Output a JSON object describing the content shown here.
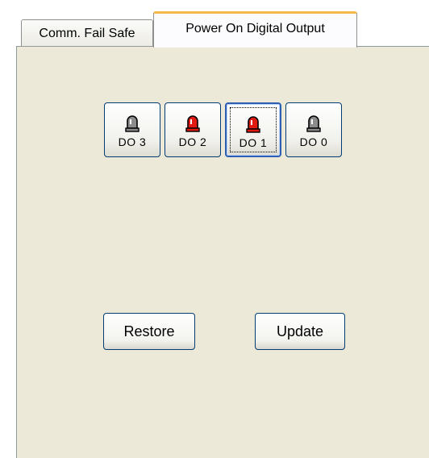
{
  "tabs": [
    {
      "label": "Comm. Fail Safe",
      "active": false
    },
    {
      "label": "Power On Digital Output",
      "active": true
    }
  ],
  "digital_outputs": [
    {
      "label": "DO 3",
      "state": "off",
      "icon": "lamp-off-icon"
    },
    {
      "label": "DO 2",
      "state": "on",
      "icon": "lamp-on-icon"
    },
    {
      "label": "DO 1",
      "state": "on",
      "icon": "lamp-on-icon"
    },
    {
      "label": "DO 0",
      "state": "off",
      "icon": "lamp-off-icon"
    }
  ],
  "buttons": {
    "restore_label": "Restore",
    "update_label": "Update"
  },
  "colors": {
    "lamp_on": "#e21b12",
    "lamp_off": "#8c8c8c",
    "active_tab_accent": "#f5b947",
    "panel_background": "#ece9d8"
  }
}
